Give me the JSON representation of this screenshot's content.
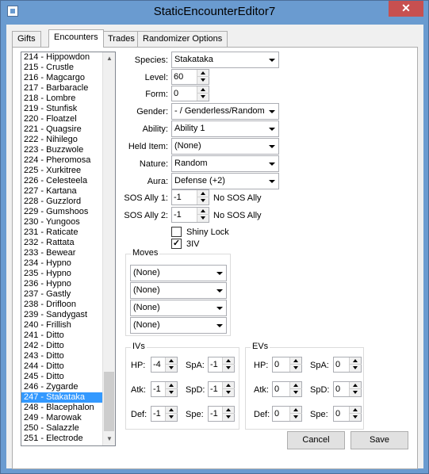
{
  "window": {
    "title": "StaticEncounterEditor7",
    "close_glyph": "✕"
  },
  "tabs": [
    "Gifts",
    "Encounters",
    "Trades",
    "Randomizer Options"
  ],
  "encounter_list": [
    "214 - Hippowdon",
    "215 - Crustle",
    "216 - Magcargo",
    "217 - Barbaracle",
    "218 - Lombre",
    "219 - Stunfisk",
    "220 - Floatzel",
    "221 - Quagsire",
    "222 - Nihilego",
    "223 - Buzzwole",
    "224 - Pheromosa",
    "225 - Xurkitree",
    "226 - Celesteela",
    "227 - Kartana",
    "228 - Guzzlord",
    "229 - Gumshoos",
    "230 - Yungoos",
    "231 - Raticate",
    "232 - Rattata",
    "233 - Bewear",
    "234 - Hypno",
    "235 - Hypno",
    "236 - Hypno",
    "237 - Gastly",
    "238 - Drifloon",
    "239 - Sandygast",
    "240 - Frillish",
    "241 - Ditto",
    "242 - Ditto",
    "243 - Ditto",
    "244 - Ditto",
    "245 - Ditto",
    "246 - Zygarde",
    "247 - Stakataka",
    "248 - Blacephalon",
    "249 - Marowak",
    "250 - Salazzle",
    "251 - Electrode"
  ],
  "selected_index": 33,
  "form": {
    "species_label": "Species:",
    "species_value": "Stakataka",
    "level_label": "Level:",
    "level_value": "60",
    "form_label": "Form:",
    "form_value": "0",
    "gender_label": "Gender:",
    "gender_value": "- / Genderless/Random",
    "ability_label": "Ability:",
    "ability_value": "Ability 1",
    "held_item_label": "Held Item:",
    "held_item_value": "(None)",
    "nature_label": "Nature:",
    "nature_value": "Random",
    "aura_label": "Aura:",
    "aura_value": "Defense (+2)",
    "sos1_label": "SOS Ally 1:",
    "sos1_value": "-1",
    "sos1_text": "No SOS Ally",
    "sos2_label": "SOS Ally 2:",
    "sos2_value": "-1",
    "sos2_text": "No SOS Ally",
    "shiny_label": "Shiny Lock",
    "shiny_checked": false,
    "iv3_label": "3IV",
    "iv3_checked": true,
    "check_glyph": "✓"
  },
  "moves": {
    "title": "Moves",
    "values": [
      "(None)",
      "(None)",
      "(None)",
      "(None)"
    ]
  },
  "ivs": {
    "title": "IVs",
    "hp_label": "HP:",
    "hp": "-4",
    "atk_label": "Atk:",
    "atk": "-1",
    "def_label": "Def:",
    "def": "-1",
    "spa_label": "SpA:",
    "spa": "-1",
    "spd_label": "SpD:",
    "spd": "-1",
    "spe_label": "Spe:",
    "spe": "-1"
  },
  "evs": {
    "title": "EVs",
    "hp_label": "HP:",
    "hp": "0",
    "atk_label": "Atk:",
    "atk": "0",
    "def_label": "Def:",
    "def": "0",
    "spa_label": "SpA:",
    "spa": "0",
    "spd_label": "SpD:",
    "spd": "0",
    "spe_label": "Spe:",
    "spe": "0"
  },
  "buttons": {
    "cancel": "Cancel",
    "save": "Save"
  },
  "colors": {
    "titlebar": "#6a9bd0",
    "selection": "#3399ff",
    "close": "#c75050"
  }
}
